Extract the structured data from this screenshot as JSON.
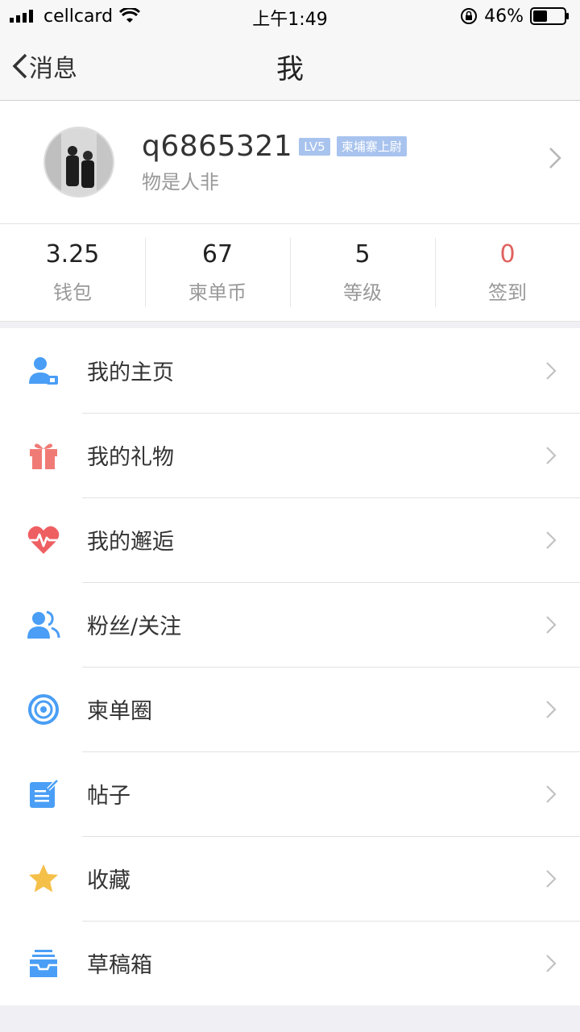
{
  "status_bar": {
    "carrier": "cellcard",
    "time": "上午1:49",
    "battery": "46%",
    "battery_level": 0.46
  },
  "nav": {
    "back_label": "消息",
    "title": "我"
  },
  "profile": {
    "username": "q6865321",
    "level_badge": "LV5",
    "rank_badge": "柬埔寨上尉",
    "signature": "物是人非"
  },
  "stats": [
    {
      "value": "3.25",
      "label": "钱包"
    },
    {
      "value": "67",
      "label": "柬单币"
    },
    {
      "value": "5",
      "label": "等级"
    },
    {
      "value": "0",
      "label": "签到"
    }
  ],
  "menu": [
    {
      "label": "我的主页",
      "icon": "user-home-icon",
      "color": "#4a9ef5"
    },
    {
      "label": "我的礼物",
      "icon": "gift-icon",
      "color": "#f07b76"
    },
    {
      "label": "我的邂逅",
      "icon": "heartbeat-icon",
      "color": "#ee5f62"
    },
    {
      "label": "粉丝/关注",
      "icon": "followers-icon",
      "color": "#4a9ef5"
    },
    {
      "label": "柬单圈",
      "icon": "circle-target-icon",
      "color": "#4a9ef5"
    },
    {
      "label": "帖子",
      "icon": "post-edit-icon",
      "color": "#4a9ef5"
    },
    {
      "label": "收藏",
      "icon": "star-icon",
      "color": "#f5c04a"
    },
    {
      "label": "草稿箱",
      "icon": "drafts-tray-icon",
      "color": "#4a9ef5"
    }
  ]
}
